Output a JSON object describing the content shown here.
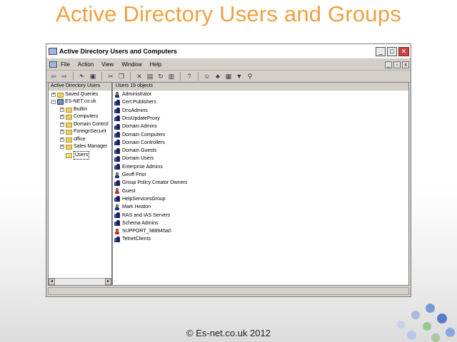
{
  "slide": {
    "title": "Active Directory Users and Groups",
    "footer": "© Es-net.co.uk 2012"
  },
  "window": {
    "title": "Active Directory Users and Computers",
    "buttons": {
      "minimize": "_",
      "maximize": "□",
      "close": "✕"
    }
  },
  "menu": {
    "items": [
      "File",
      "Action",
      "View",
      "Window",
      "Help"
    ]
  },
  "toolbar": {
    "icons": [
      "back-icon",
      "forward-icon",
      "up-icon",
      "show-hide-tree-icon",
      "cut-icon",
      "copy-icon",
      "delete-icon",
      "properties-icon",
      "refresh-icon",
      "export-icon",
      "help-icon",
      "new-user-icon",
      "new-group-icon",
      "new-ou-icon",
      "filter-icon",
      "find-icon"
    ]
  },
  "tree": {
    "header": "Active Directory Users",
    "items": [
      {
        "label": "Saved Queries",
        "level": 1,
        "expander": "+"
      },
      {
        "label": "ES-NET.co.uk",
        "level": 1,
        "expander": "-"
      },
      {
        "label": "Builtin",
        "level": 2,
        "expander": "+"
      },
      {
        "label": "Computers",
        "level": 2,
        "expander": "+"
      },
      {
        "label": "Domain Control",
        "level": 2,
        "expander": "+"
      },
      {
        "label": "ForeignSecurit",
        "level": 2,
        "expander": "+"
      },
      {
        "label": "office",
        "level": 2,
        "expander": "+"
      },
      {
        "label": "Sales Manager",
        "level": 2,
        "expander": "+"
      },
      {
        "label": "Users",
        "level": 2,
        "expander": ""
      }
    ]
  },
  "list": {
    "header": "Users   19 objects",
    "rows": [
      {
        "name": "Administrator",
        "type": "user"
      },
      {
        "name": "Cert Publishers",
        "type": "group"
      },
      {
        "name": "DnsAdmins",
        "type": "group"
      },
      {
        "name": "DnsUpdateProxy",
        "type": "group"
      },
      {
        "name": "Domain Admins",
        "type": "group"
      },
      {
        "name": "Domain Computers",
        "type": "group"
      },
      {
        "name": "Domain Controllers",
        "type": "group"
      },
      {
        "name": "Domain Guests",
        "type": "group"
      },
      {
        "name": "Domain Users",
        "type": "group"
      },
      {
        "name": "Enterprise Admins",
        "type": "group"
      },
      {
        "name": "Geoff Prior",
        "type": "user"
      },
      {
        "name": "Group Policy Creator Owners",
        "type": "group"
      },
      {
        "name": "Guest",
        "type": "disabled-user"
      },
      {
        "name": "HelpServicesGroup",
        "type": "group"
      },
      {
        "name": "Mark Heaton",
        "type": "user"
      },
      {
        "name": "RAS and IAS Servers",
        "type": "group"
      },
      {
        "name": "Schema Admins",
        "type": "group"
      },
      {
        "name": "SUPPORT_388945a0",
        "type": "disabled-user"
      },
      {
        "name": "TelnetClients",
        "type": "group"
      }
    ]
  },
  "colors": {
    "title": "#f0a040",
    "window_bg": "#d4d0c8"
  }
}
